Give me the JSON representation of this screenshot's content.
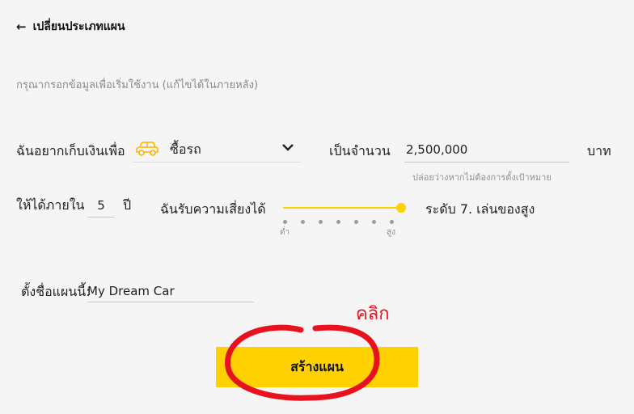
{
  "header": {
    "back_label": "เปลี่ยนประเภทแผน",
    "back_icon": "arrow-left-icon"
  },
  "subtitle": "กรุณากรอกข้อมูลเพื่อเริ่มใช้งาน (แก้ไขได้ในภายหลัง)",
  "goal": {
    "label": "ฉันอยากเก็บเงินเพื่อ",
    "icon": "car-icon",
    "value": "ซื้อรถ",
    "accent": "#ffb400"
  },
  "amount": {
    "label": "เป็นจำนวน",
    "value": "2,500,000",
    "unit": "บาท",
    "hint": "ปล่อยว่างหากไม่ต้องการตั้งเป้าหมาย"
  },
  "duration": {
    "label": "ให้ได้ภายใน",
    "value": "5",
    "unit": "ปี"
  },
  "risk": {
    "label": "ฉันรับความเสี่ยงได้",
    "low_label": "ต่ำ",
    "high_label": "สูง",
    "level_text": "ระดับ 7. เล่นของสูง",
    "level": 7,
    "max_level": 7,
    "color": "#ffd100"
  },
  "plan_name": {
    "label": "ตั้งชื่อแผนนี้:",
    "value": "My Dream Car"
  },
  "annotation": {
    "text": "คลิก",
    "color": "#e8121f"
  },
  "create_button": {
    "label": "สร้างแผน",
    "color": "#ffd100"
  }
}
